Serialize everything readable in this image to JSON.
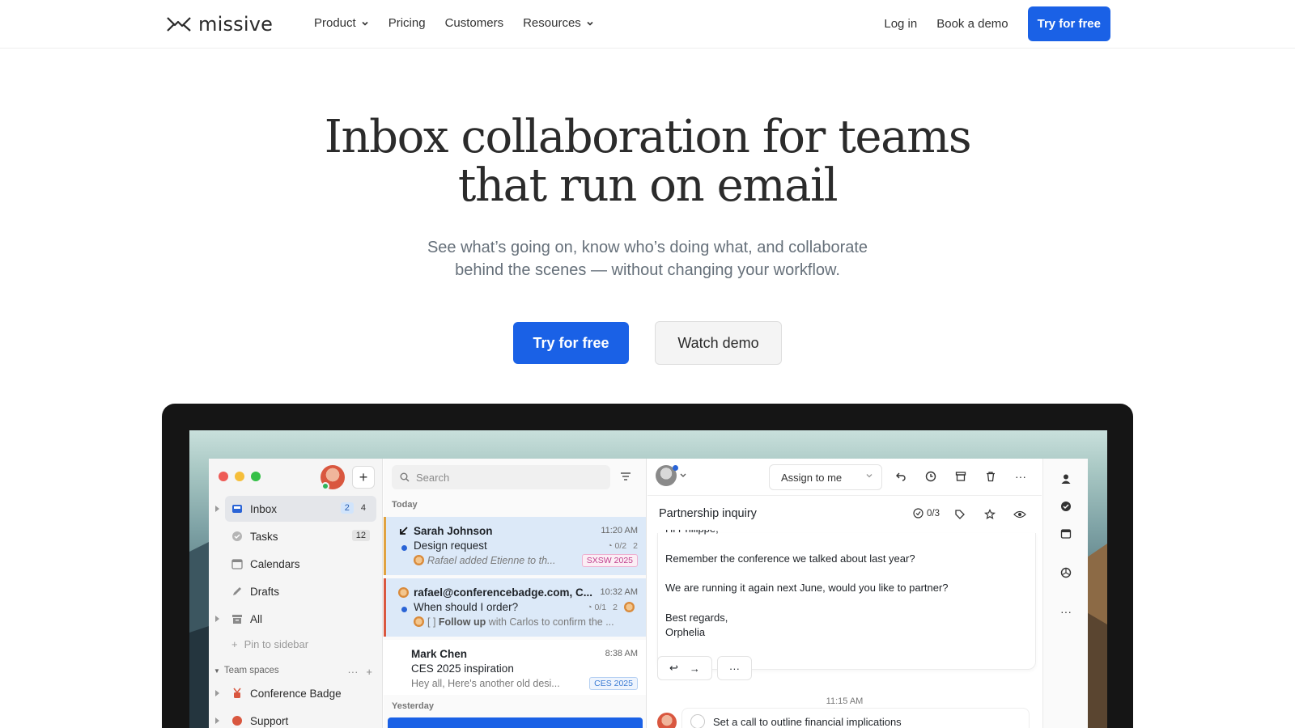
{
  "nav": {
    "logo_text": "missive",
    "links": [
      {
        "label": "Product",
        "dropdown": true
      },
      {
        "label": "Pricing",
        "dropdown": false
      },
      {
        "label": "Customers",
        "dropdown": false
      },
      {
        "label": "Resources",
        "dropdown": true
      }
    ],
    "login": "Log in",
    "book_demo": "Book a demo",
    "cta": "Try for free"
  },
  "hero": {
    "title_line1": "Inbox collaboration for teams",
    "title_line2": "that run on email",
    "subtitle_line1": "See what’s going on, know who’s doing what, and collaborate",
    "subtitle_line2": "behind the scenes — without changing your workflow.",
    "cta_primary": "Try for free",
    "cta_secondary": "Watch demo"
  },
  "colors": {
    "brand": "#1a61e6",
    "traffic_red": "#ee5b56",
    "traffic_yellow": "#f5be3a",
    "traffic_green": "#35c047"
  },
  "app": {
    "sidebar": {
      "items": [
        {
          "label": "Inbox",
          "icon": "inbox-icon",
          "badges": [
            "2",
            "4"
          ],
          "active": true
        },
        {
          "label": "Tasks",
          "icon": "check-circle-icon",
          "badges": [
            "12"
          ],
          "active": false
        },
        {
          "label": "Calendars",
          "icon": "calendar-icon",
          "badges": [],
          "active": false
        },
        {
          "label": "Drafts",
          "icon": "pencil-icon",
          "badges": [],
          "active": false
        },
        {
          "label": "All",
          "icon": "archive-box-icon",
          "badges": [],
          "active": false
        }
      ],
      "pin": "Pin to sidebar",
      "team_header": "Team spaces",
      "teams": [
        {
          "label": "Conference Badge",
          "icon": "conference-badge-icon"
        },
        {
          "label": "Support",
          "icon": "support-icon"
        }
      ]
    },
    "list": {
      "search_placeholder": "Search",
      "today": "Today",
      "yesterday": "Yesterday",
      "conversations": [
        {
          "from": "Sarah Johnson",
          "time": "11:20 AM",
          "subject": "Design request",
          "tasks": "0/2",
          "count": "2",
          "preview": "Rafael added Etienne to th...",
          "tag": "SXSW 2025"
        },
        {
          "from": "rafael@conferencebadge.com, C...",
          "time": "10:32 AM",
          "subject": "When should I order?",
          "tasks": "0/1",
          "count": "2",
          "preview_prefix": "[ ] ",
          "preview_bold": "Follow up",
          "preview_rest": " with Carlos to confirm the ..."
        },
        {
          "from": "Mark Chen",
          "time": "8:38 AM",
          "subject": "CES 2025 inspiration",
          "preview": "Hey all, Here's another old desi...",
          "tag": "CES 2025"
        }
      ]
    },
    "message": {
      "assign_label": "Assign to me",
      "subject": "Partnership inquiry",
      "tasks": "0/3",
      "body": [
        "Hi Philippe,",
        "Remember the conference we talked about last year?",
        "We are running it again next June, would you like to partner?",
        "Best regards,",
        "Orphelia"
      ],
      "timestamp": "11:15 AM",
      "task_text": "Set a call to outline financial implications"
    },
    "rail_icons": [
      "person-icon",
      "check-badge-icon",
      "calendar-icon",
      "openai-icon",
      "more-icon"
    ]
  }
}
